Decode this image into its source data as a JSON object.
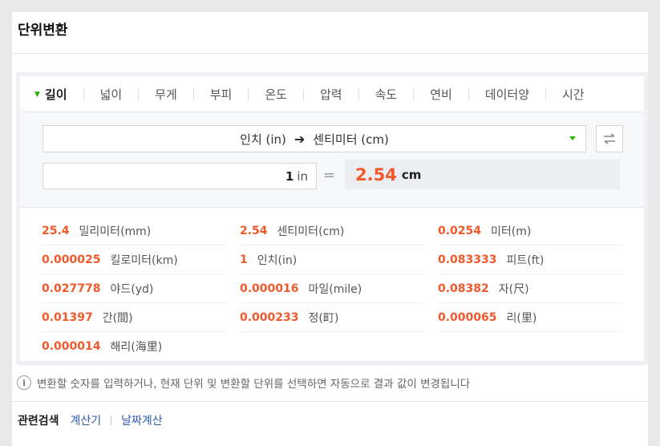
{
  "title": "단위변환",
  "tabs": [
    {
      "label": "길이",
      "active": true
    },
    {
      "label": "넓이"
    },
    {
      "label": "무게"
    },
    {
      "label": "부피"
    },
    {
      "label": "온도"
    },
    {
      "label": "압력"
    },
    {
      "label": "속도"
    },
    {
      "label": "연비"
    },
    {
      "label": "데이터양"
    },
    {
      "label": "시간"
    }
  ],
  "converter": {
    "from_label": "인치 (in)",
    "arrow": "➔",
    "to_label": "센티미터 (cm)",
    "input_value": "1",
    "input_unit": "in",
    "equals": "=",
    "result_value": "2.54",
    "result_unit": "cm"
  },
  "results": [
    {
      "value": "25.4",
      "name": "밀리미터(mm)"
    },
    {
      "value": "2.54",
      "name": "센티미터(cm)"
    },
    {
      "value": "0.0254",
      "name": "미터(m)"
    },
    {
      "value": "0.000025",
      "name": "킬로미터(km)"
    },
    {
      "value": "1",
      "name": "인치(in)"
    },
    {
      "value": "0.083333",
      "name": "피트(ft)"
    },
    {
      "value": "0.027778",
      "name": "야드(yd)"
    },
    {
      "value": "0.000016",
      "name": "마일(mile)"
    },
    {
      "value": "0.08382",
      "name": "자(尺)"
    },
    {
      "value": "0.01397",
      "name": "간(間)"
    },
    {
      "value": "0.000233",
      "name": "정(町)"
    },
    {
      "value": "0.000065",
      "name": "리(里)"
    },
    {
      "value": "0.000014",
      "name": "해리(海里)"
    }
  ],
  "info": {
    "icon": "i",
    "text": "변환할 숫자를 입력하거나, 현재 단위 및 변환할 단위를 선택하면 자동으로 결과 값이 변경됩니다"
  },
  "related": {
    "label": "관련검색",
    "links": [
      "계산기",
      "날짜계산"
    ]
  },
  "colors": {
    "accent": "#f0592b",
    "green": "#2db400",
    "link": "#2e5bb3"
  }
}
